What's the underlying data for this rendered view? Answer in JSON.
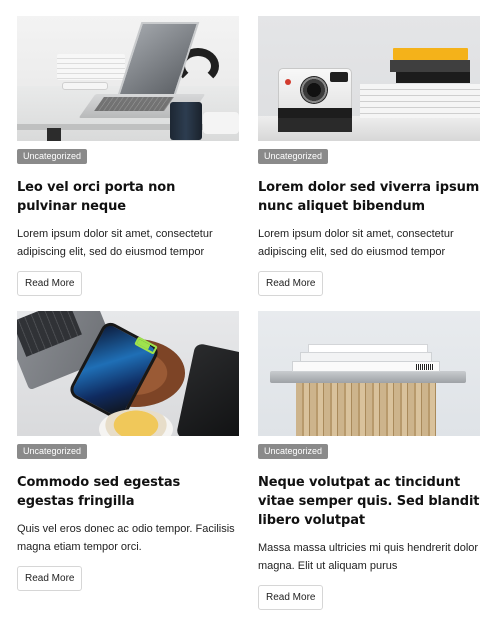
{
  "posts": [
    {
      "category": "Uncategorized",
      "title": "Leo vel orci porta non pulvinar neque",
      "excerpt": "Lorem ipsum dolor sit amet, consectetur adipiscing elit, sed do eiusmod tempor",
      "button": "Read More",
      "image": "laptop-desk-image"
    },
    {
      "category": "Uncategorized",
      "title": "Lorem dolor sed viverra ipsum nunc aliquet bibendum",
      "excerpt": "Lorem ipsum dolor sit amet, consectetur adipiscing elit, sed do eiusmod tempor",
      "button": "Read More",
      "image": "polaroid-camera-books-image"
    },
    {
      "category": "Uncategorized",
      "title": "Commodo sed egestas egestas fringilla",
      "excerpt": "Quis vel eros donec ac odio tempor. Facilisis magna etiam tempor orci.",
      "button": "Read More",
      "image": "phone-wireless-charger-image"
    },
    {
      "category": "Uncategorized",
      "title": "Neque volutpat ac tincidunt vitae semper quis. Sed blandit libero volutpat",
      "excerpt": "Massa massa ultricies mi quis hendrerit dolor magna. Elit ut aliquam purus",
      "button": "Read More",
      "image": "books-on-wood-stump-image"
    }
  ],
  "colors": {
    "badge_bg": "#8a8a8a",
    "title": "#111111",
    "button_border": "#d6d6d6"
  }
}
